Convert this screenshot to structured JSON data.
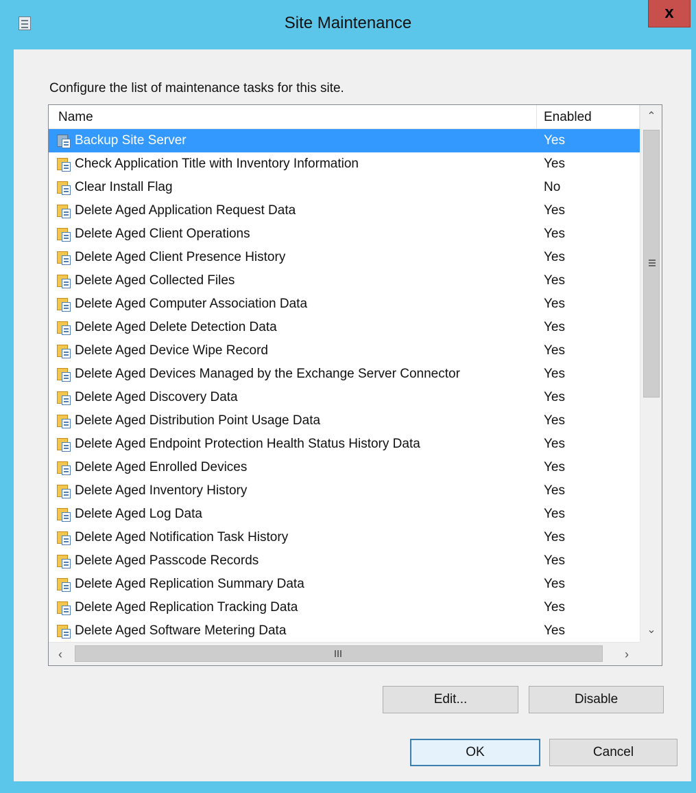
{
  "window": {
    "title": "Site Maintenance",
    "close_label": "x"
  },
  "instruction": "Configure the list of maintenance tasks for this site.",
  "columns": {
    "name": "Name",
    "enabled": "Enabled"
  },
  "tasks": [
    {
      "name": "Backup Site Server",
      "enabled": "Yes"
    },
    {
      "name": "Check Application Title with Inventory Information",
      "enabled": "Yes"
    },
    {
      "name": "Clear Install Flag",
      "enabled": "No"
    },
    {
      "name": "Delete Aged Application Request Data",
      "enabled": "Yes"
    },
    {
      "name": "Delete Aged Client Operations",
      "enabled": "Yes"
    },
    {
      "name": "Delete Aged Client Presence History",
      "enabled": "Yes"
    },
    {
      "name": "Delete Aged Collected Files",
      "enabled": "Yes"
    },
    {
      "name": "Delete Aged Computer Association Data",
      "enabled": "Yes"
    },
    {
      "name": "Delete Aged Delete Detection Data",
      "enabled": "Yes"
    },
    {
      "name": "Delete Aged Device Wipe Record",
      "enabled": "Yes"
    },
    {
      "name": "Delete Aged Devices Managed by the Exchange Server Connector",
      "enabled": "Yes"
    },
    {
      "name": "Delete Aged Discovery Data",
      "enabled": "Yes"
    },
    {
      "name": "Delete Aged Distribution Point Usage Data",
      "enabled": "Yes"
    },
    {
      "name": "Delete Aged Endpoint Protection Health Status History Data",
      "enabled": "Yes"
    },
    {
      "name": "Delete Aged Enrolled Devices",
      "enabled": "Yes"
    },
    {
      "name": "Delete Aged Inventory History",
      "enabled": "Yes"
    },
    {
      "name": "Delete Aged Log Data",
      "enabled": "Yes"
    },
    {
      "name": "Delete Aged Notification Task History",
      "enabled": "Yes"
    },
    {
      "name": "Delete Aged Passcode Records",
      "enabled": "Yes"
    },
    {
      "name": "Delete Aged Replication Summary Data",
      "enabled": "Yes"
    },
    {
      "name": "Delete Aged Replication Tracking Data",
      "enabled": "Yes"
    },
    {
      "name": "Delete Aged Software Metering Data",
      "enabled": "Yes"
    }
  ],
  "selected_task": "Backup Site Server",
  "buttons": {
    "edit": "Edit...",
    "disable": "Disable",
    "ok": "OK",
    "cancel": "Cancel"
  },
  "scrollbars": {
    "up_icon": "chevron-up-icon",
    "down_icon": "chevron-down-icon",
    "left_icon": "chevron-left-icon",
    "right_icon": "chevron-right-icon"
  },
  "colors": {
    "titlebar": "#5cc6ea",
    "selection": "#3399ff",
    "close": "#c7504c"
  }
}
